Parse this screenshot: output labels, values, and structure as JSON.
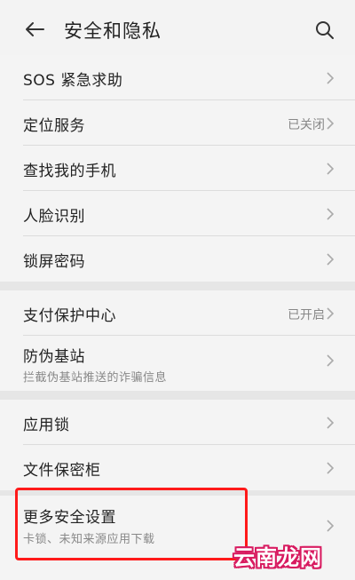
{
  "header": {
    "title": "安全和隐私",
    "back_icon": "arrow-left-icon",
    "search_icon": "search-icon"
  },
  "groups": [
    [
      {
        "label": "SOS 紧急求助"
      },
      {
        "label": "定位服务",
        "status": "已关闭"
      },
      {
        "label": "查找我的手机"
      },
      {
        "label": "人脸识别"
      },
      {
        "label": "锁屏密码"
      }
    ],
    [
      {
        "label": "支付保护中心",
        "status": "已开启"
      },
      {
        "label": "防伪基站",
        "sub": "拦截伪基站推送的诈骗信息"
      }
    ],
    [
      {
        "label": "应用锁"
      },
      {
        "label": "文件保密柜"
      }
    ],
    [
      {
        "label": "更多安全设置",
        "sub": "卡锁、未知来源应用下载"
      }
    ]
  ],
  "watermark": "云南龙网",
  "colors": {
    "highlight": "#ff1a1a",
    "watermark_outline": "#d81b60"
  }
}
